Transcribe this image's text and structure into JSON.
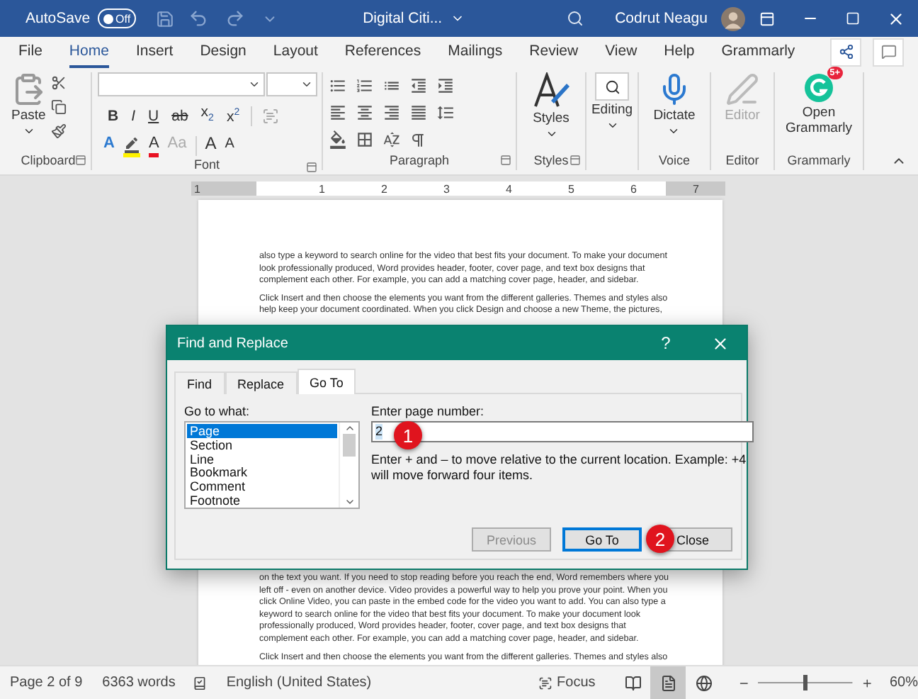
{
  "title_bar": {
    "autosave_label": "AutoSave",
    "autosave_toggle": {
      "label": "Off",
      "on": false
    },
    "document_title": "Digital Citi...",
    "user_name": "Codrut Neagu"
  },
  "ribbon_tabs": [
    {
      "label": "File",
      "selected": false
    },
    {
      "label": "Home",
      "selected": true
    },
    {
      "label": "Insert",
      "selected": false
    },
    {
      "label": "Design",
      "selected": false
    },
    {
      "label": "Layout",
      "selected": false
    },
    {
      "label": "References",
      "selected": false
    },
    {
      "label": "Mailings",
      "selected": false
    },
    {
      "label": "Review",
      "selected": false
    },
    {
      "label": "View",
      "selected": false
    },
    {
      "label": "Help",
      "selected": false
    },
    {
      "label": "Grammarly",
      "selected": false
    }
  ],
  "ribbon": {
    "clipboard": {
      "paste": "Paste",
      "label": "Clipboard"
    },
    "font": {
      "label": "Font",
      "format_buttons": [
        {
          "text": "B",
          "kind": "bold"
        },
        {
          "text": "I",
          "kind": "italic"
        },
        {
          "text": "U",
          "kind": "underline"
        },
        {
          "text": "ab",
          "kind": "strike"
        },
        {
          "text": "x$_{2}$",
          "kind": "plain"
        },
        {
          "text": "x$^{2}$",
          "kind": "plain"
        }
      ],
      "effect_buttons": [
        {
          "text": "A",
          "kind": "effects"
        },
        {
          "text": "A",
          "kind": "color"
        },
        {
          "text": "Aa",
          "kind": "case"
        },
        {
          "text": "A",
          "kind": "grow"
        },
        {
          "text": "A",
          "kind": "shrink"
        }
      ]
    },
    "paragraph": {
      "label": "Paragraph"
    },
    "styles": {
      "button": "Styles",
      "label": "Styles"
    },
    "editing": {
      "button": "Editing"
    },
    "voice": {
      "button": "Dictate",
      "label": "Voice"
    },
    "editor": {
      "button": "Editor",
      "label": "Editor",
      "disabled": true
    },
    "grammarly": {
      "button": "Open Grammarly",
      "badge": "5+",
      "label": "Grammarly"
    }
  },
  "ruler": {
    "marks": [
      "1",
      "1",
      "2",
      "3",
      "4",
      "5",
      "6",
      "7"
    ]
  },
  "document": {
    "top_paragraphs": [
      "also type a keyword to search online for the video that best fits your document. To make your document look professionally produced, Word provides header, footer, cover page, and text box designs that complement each other. For example, you can add a matching cover page, header, and sidebar.",
      "Click Insert and then choose the elements you want from the different galleries. Themes and styles also help keep your document coordinated. When you click Design and choose a new Theme, the pictures,"
    ],
    "bottom_paragraphs": [
      "on the text you want. If you need to stop reading before you reach the end, Word remembers where you left off - even on another device. Video provides a powerful way to help you prove your point. When you click Online Video, you can paste in the embed code for the video you want to add. You can also type a keyword to search online for the video that best fits your document. To make your document look professionally produced, Word provides header, footer, cover page, and text box designs that complement each other. For example, you can add a matching cover page, header, and sidebar.",
      "Click Insert and then choose the elements you want from the different galleries. Themes and styles also"
    ]
  },
  "dialog": {
    "title": "Find and Replace",
    "help": "?",
    "tabs": [
      {
        "label": "Find",
        "selected": false
      },
      {
        "label": "Replace",
        "selected": false
      },
      {
        "label": "Go To",
        "selected": true
      }
    ],
    "go_to_label": "Go to what:",
    "go_to_items": [
      {
        "label": "Page",
        "selected": true
      },
      {
        "label": "Section",
        "selected": false
      },
      {
        "label": "Line",
        "selected": false
      },
      {
        "label": "Bookmark",
        "selected": false
      },
      {
        "label": "Comment",
        "selected": false
      },
      {
        "label": "Footnote",
        "selected": false
      }
    ],
    "page_number_label": "Enter page number:",
    "page_number_value": "2",
    "hint": "Enter + and – to move relative to the current location. Example: +4 will move forward four items.",
    "buttons": [
      {
        "label": "Previous",
        "disabled": true,
        "default": false
      },
      {
        "label": "Go To",
        "disabled": false,
        "default": true
      },
      {
        "label": "Close",
        "disabled": false,
        "default": false
      }
    ],
    "markers": [
      {
        "text": "1"
      },
      {
        "text": "2"
      }
    ]
  },
  "status_bar": {
    "page": "Page 2 of 9",
    "words": "6363 words",
    "language": "English (United States)",
    "focus": "Focus",
    "views": [
      {
        "kind": "read",
        "selected": false
      },
      {
        "kind": "print",
        "selected": true
      },
      {
        "kind": "web",
        "selected": false
      }
    ],
    "zoom": {
      "level": 0.48,
      "reading": "60%"
    }
  }
}
